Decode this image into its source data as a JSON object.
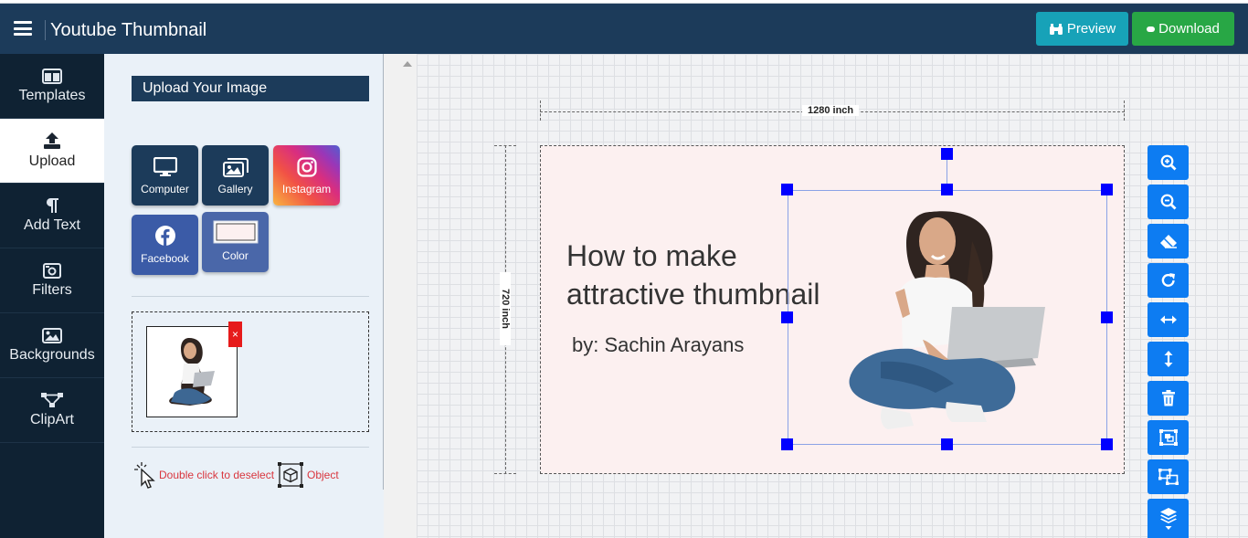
{
  "header": {
    "title": "Youtube Thumbnail",
    "preview_label": "Preview",
    "download_label": "Download"
  },
  "nav": [
    {
      "label": "Templates",
      "icon": "columns-icon"
    },
    {
      "label": "Upload",
      "icon": "upload-icon",
      "active": true
    },
    {
      "label": "Add Text",
      "icon": "paragraph-icon"
    },
    {
      "label": "Filters",
      "icon": "camera-icon"
    },
    {
      "label": "Backgrounds",
      "icon": "image-icon"
    },
    {
      "label": "ClipArt",
      "icon": "vector-icon"
    }
  ],
  "panel": {
    "upload_heading": "Upload Your Image",
    "sources": [
      {
        "label": "Computer",
        "icon": "desktop-icon"
      },
      {
        "label": "Gallery",
        "icon": "images-icon"
      },
      {
        "label": "Instagram",
        "icon": "instagram-icon"
      },
      {
        "label": "Facebook",
        "icon": "facebook-icon"
      },
      {
        "label": "Color",
        "icon": "color-swatch-icon"
      }
    ],
    "remove_symbol": "×",
    "hint_deselect": "Double click to deselect",
    "hint_object": "Object"
  },
  "canvas": {
    "width_label": "1280 inch",
    "height_label": "720 inch",
    "headline_line1": "How to make",
    "headline_line2": "attractive thumbnail",
    "byline": "by: Sachin Arayans",
    "background_color": "#fcf0f0"
  },
  "tools": [
    "zoom-in-icon",
    "zoom-out-icon",
    "eraser-icon",
    "redo-icon",
    "flip-horizontal-icon",
    "flip-vertical-icon",
    "trash-icon",
    "group-icon",
    "ungroup-icon",
    "layers-icon"
  ],
  "colors": {
    "header": "#1c3b5a",
    "preview": "#17a2b8",
    "download": "#28a745",
    "tool": "#0d7cf2",
    "handle": "#0000ff"
  }
}
